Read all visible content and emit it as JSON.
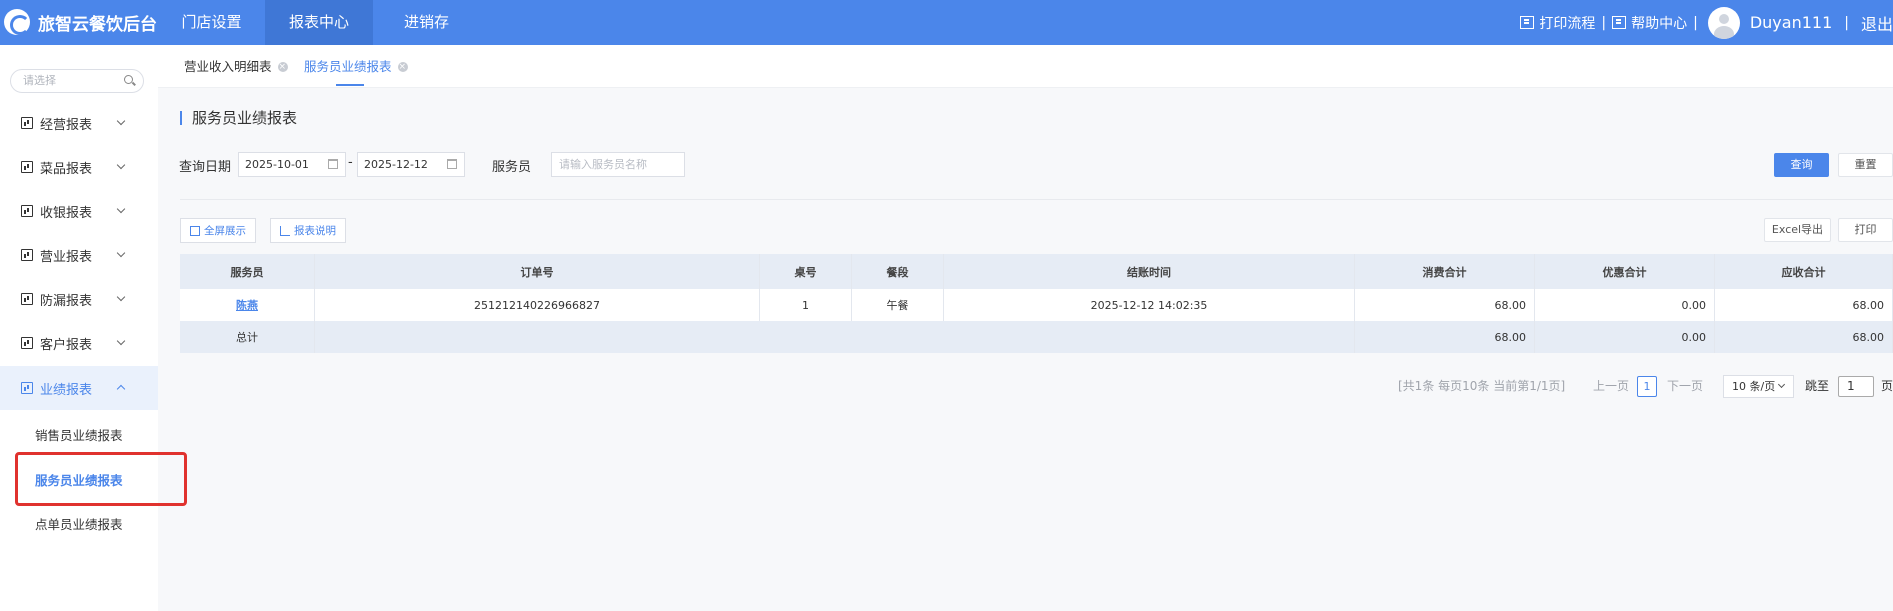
{
  "app": {
    "title": "旅智云餐饮后台"
  },
  "nav": {
    "items": [
      {
        "label": "门店设置"
      },
      {
        "label": "报表中心"
      },
      {
        "label": "进销存"
      }
    ]
  },
  "header": {
    "print_flow": "打印流程",
    "help_center": "帮助中心",
    "separator": "|",
    "username": "Duyan111",
    "logout": "退出"
  },
  "sidebar": {
    "search_placeholder": "请选择",
    "menu": [
      {
        "label": "经营报表"
      },
      {
        "label": "菜品报表"
      },
      {
        "label": "收银报表"
      },
      {
        "label": "营业报表"
      },
      {
        "label": "防漏报表"
      },
      {
        "label": "客户报表"
      },
      {
        "label": "业绩报表"
      }
    ],
    "sub_items": [
      {
        "label": "销售员业绩报表"
      },
      {
        "label": "服务员业绩报表"
      },
      {
        "label": "点单员业绩报表"
      }
    ]
  },
  "tabs": [
    {
      "label": "营业收入明细表"
    },
    {
      "label": "服务员业绩报表"
    }
  ],
  "page": {
    "title": "服务员业绩报表",
    "query_date_label": "查询日期",
    "date_start": "2025-10-01",
    "date_sep": "-",
    "date_end": "2025-12-12",
    "waiter_label": "服务员",
    "waiter_placeholder": "请输入服务员名称",
    "query_button": "查询",
    "reset_button": "重置",
    "fullscreen_button": "全屏展示",
    "report_desc_button": "报表说明",
    "excel_button": "Excel导出",
    "print_button": "打印"
  },
  "table": {
    "headers": [
      "服务员",
      "订单号",
      "桌号",
      "餐段",
      "结账时间",
      "消费合计",
      "优惠合计",
      "应收合计"
    ],
    "rows": [
      [
        "陈燕",
        "251212140226966827",
        "1",
        "午餐",
        "2025-12-12 14:02:35",
        "68.00",
        "0.00",
        "68.00"
      ]
    ],
    "total": [
      "总计",
      "",
      "",
      "",
      "",
      "68.00",
      "0.00",
      "68.00"
    ]
  },
  "pagination": {
    "summary": "[共1条 每页10条 当前第1/1页]",
    "prev": "上一页",
    "current": "1",
    "next": "下一页",
    "page_size": "10 条/页",
    "jump_label": "跳至",
    "jump_value": "1",
    "page_suffix": "页"
  },
  "colors": {
    "brand": "#4b86ea",
    "highlight": "#e0322e"
  }
}
